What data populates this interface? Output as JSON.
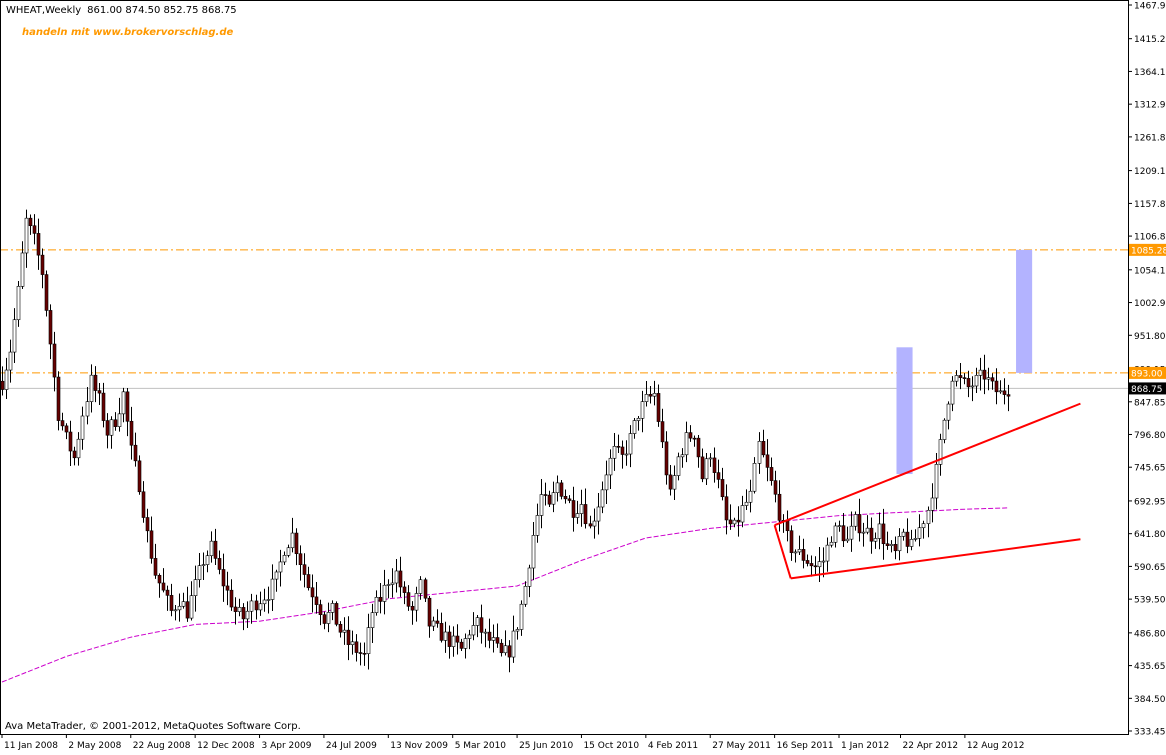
{
  "header": {
    "symbol": "WHEAT,Weekly",
    "ohlc": "861.00 874.50 852.75 868.75",
    "promo": "handeln mit www.brokervorschlag.de"
  },
  "footer": {
    "copyright": "Ava MetaTrader, © 2001-2012, MetaQuotes Software Corp."
  },
  "colors": {
    "background": "#ffffff",
    "frame": "#000000",
    "candle_up": "#ffffff",
    "candle_down": "#660000",
    "candle_outline": "#000000",
    "moving_average": "#cc00cc",
    "level_line": "#ff9900",
    "trendline": "#ff0000",
    "target_box": "#b3b3ff",
    "promo_text": "#ff9900",
    "current_price_bg": "#000000",
    "level_tag_bg": "#ff9900"
  },
  "chart_data": {
    "type": "candlestick",
    "symbol": "WHEAT",
    "timeframe": "Weekly",
    "ylim": [
      333.45,
      1467.9
    ],
    "y_ticks": [
      1467.9,
      1415.25,
      1364.1,
      1312.95,
      1261.8,
      1209.15,
      1157.85,
      1106.8,
      1054.1,
      1002.95,
      951.8,
      899.15,
      847.85,
      796.8,
      745.65,
      692.95,
      641.8,
      590.65,
      539.5,
      486.8,
      435.65,
      384.5,
      333.45
    ],
    "y_tick_labels": [
      "1467.90",
      "1415.25",
      "1364.10",
      "1312.95",
      "1261.80",
      "1209.15",
      "1157.85",
      "1106.80",
      "1054.10",
      "1002.95",
      "951.80",
      "899.15",
      "847.85",
      "796.80",
      "745.65",
      "692.95",
      "641.80",
      "590.65",
      "539.50",
      "486.80",
      "435.65",
      "384.50",
      "333.45"
    ],
    "x_start": "2008-01-11",
    "x_end": "2012-10-26",
    "x_ticks": [
      "2008-01-11",
      "2008-05-02",
      "2008-08-22",
      "2008-12-12",
      "2009-04-03",
      "2009-07-24",
      "2009-11-13",
      "2010-03-05",
      "2010-06-25",
      "2010-10-15",
      "2011-02-04",
      "2011-05-27",
      "2011-09-16",
      "2012-01-06",
      "2012-04-22",
      "2012-08-12"
    ],
    "x_tick_labels": [
      "11 Jan 2008",
      "2 May 2008",
      "22 Aug 2008",
      "12 Dec 2008",
      "3 Apr 2009",
      "24 Jul 2009",
      "13 Nov 2009",
      "5 Mar 2010",
      "25 Jun 2010",
      "15 Oct 2010",
      "4 Feb 2011",
      "27 May 2011",
      "16 Sep 2011",
      "1 Jan 2012",
      "22 Apr 2012",
      "12 Aug 2012"
    ],
    "price_path": [
      [
        "2008-01-11",
        880
      ],
      [
        "2008-01-25",
        930
      ],
      [
        "2008-02-08",
        1020
      ],
      [
        "2008-02-22",
        1130
      ],
      [
        "2008-03-07",
        1100
      ],
      [
        "2008-03-21",
        1050
      ],
      [
        "2008-04-04",
        940
      ],
      [
        "2008-04-18",
        830
      ],
      [
        "2008-05-02",
        790
      ],
      [
        "2008-05-16",
        760
      ],
      [
        "2008-05-30",
        830
      ],
      [
        "2008-06-13",
        880
      ],
      [
        "2008-06-27",
        850
      ],
      [
        "2008-07-11",
        800
      ],
      [
        "2008-07-25",
        820
      ],
      [
        "2008-08-08",
        860
      ],
      [
        "2008-08-22",
        770
      ],
      [
        "2008-09-05",
        720
      ],
      [
        "2008-09-19",
        640
      ],
      [
        "2008-10-03",
        580
      ],
      [
        "2008-10-17",
        550
      ],
      [
        "2008-10-31",
        520
      ],
      [
        "2008-11-14",
        540
      ],
      [
        "2008-11-28",
        520
      ],
      [
        "2008-12-12",
        560
      ],
      [
        "2008-12-26",
        600
      ],
      [
        "2009-01-09",
        620
      ],
      [
        "2009-01-23",
        580
      ],
      [
        "2009-02-06",
        550
      ],
      [
        "2009-02-20",
        520
      ],
      [
        "2009-03-06",
        510
      ],
      [
        "2009-03-20",
        530
      ],
      [
        "2009-04-03",
        540
      ],
      [
        "2009-04-17",
        550
      ],
      [
        "2009-05-01",
        570
      ],
      [
        "2009-05-15",
        620
      ],
      [
        "2009-05-29",
        640
      ],
      [
        "2009-06-12",
        600
      ],
      [
        "2009-06-26",
        560
      ],
      [
        "2009-07-10",
        540
      ],
      [
        "2009-07-24",
        510
      ],
      [
        "2009-08-07",
        520
      ],
      [
        "2009-08-21",
        490
      ],
      [
        "2009-09-04",
        470
      ],
      [
        "2009-09-18",
        460
      ],
      [
        "2009-10-02",
        450
      ],
      [
        "2009-10-16",
        520
      ],
      [
        "2009-10-30",
        540
      ],
      [
        "2009-11-13",
        570
      ],
      [
        "2009-11-27",
        580
      ],
      [
        "2009-12-11",
        540
      ],
      [
        "2009-12-25",
        520
      ],
      [
        "2010-01-08",
        560
      ],
      [
        "2010-01-22",
        500
      ],
      [
        "2010-02-05",
        490
      ],
      [
        "2010-02-19",
        480
      ],
      [
        "2010-03-05",
        470
      ],
      [
        "2010-03-19",
        460
      ],
      [
        "2010-04-02",
        490
      ],
      [
        "2010-04-16",
        500
      ],
      [
        "2010-04-30",
        480
      ],
      [
        "2010-05-14",
        470
      ],
      [
        "2010-05-28",
        450
      ],
      [
        "2010-06-11",
        460
      ],
      [
        "2010-06-25",
        500
      ],
      [
        "2010-07-09",
        560
      ],
      [
        "2010-07-23",
        640
      ],
      [
        "2010-08-06",
        700
      ],
      [
        "2010-08-20",
        680
      ],
      [
        "2010-09-03",
        720
      ],
      [
        "2010-09-17",
        700
      ],
      [
        "2010-10-01",
        680
      ],
      [
        "2010-10-15",
        690
      ],
      [
        "2010-10-29",
        650
      ],
      [
        "2010-11-12",
        690
      ],
      [
        "2010-11-26",
        740
      ],
      [
        "2010-12-10",
        770
      ],
      [
        "2010-12-24",
        760
      ],
      [
        "2011-01-07",
        790
      ],
      [
        "2011-01-21",
        830
      ],
      [
        "2011-02-04",
        850
      ],
      [
        "2011-02-18",
        860
      ],
      [
        "2011-03-04",
        780
      ],
      [
        "2011-03-18",
        700
      ],
      [
        "2011-04-01",
        760
      ],
      [
        "2011-04-15",
        790
      ],
      [
        "2011-04-29",
        800
      ],
      [
        "2011-05-13",
        730
      ],
      [
        "2011-05-27",
        770
      ],
      [
        "2011-06-10",
        720
      ],
      [
        "2011-06-24",
        660
      ],
      [
        "2011-07-08",
        650
      ],
      [
        "2011-07-22",
        680
      ],
      [
        "2011-08-05",
        700
      ],
      [
        "2011-08-19",
        780
      ],
      [
        "2011-09-02",
        740
      ],
      [
        "2011-09-16",
        700
      ],
      [
        "2011-09-30",
        650
      ],
      [
        "2011-10-14",
        620
      ],
      [
        "2011-10-28",
        610
      ],
      [
        "2011-11-11",
        600
      ],
      [
        "2011-11-25",
        590
      ],
      [
        "2011-12-09",
        600
      ],
      [
        "2011-12-23",
        640
      ],
      [
        "2012-01-06",
        650
      ],
      [
        "2012-01-20",
        630
      ],
      [
        "2012-02-03",
        660
      ],
      [
        "2012-02-17",
        650
      ],
      [
        "2012-03-02",
        640
      ],
      [
        "2012-03-16",
        650
      ],
      [
        "2012-03-30",
        620
      ],
      [
        "2012-04-13",
        610
      ],
      [
        "2012-04-27",
        640
      ],
      [
        "2012-05-11",
        620
      ],
      [
        "2012-05-25",
        650
      ],
      [
        "2012-06-08",
        680
      ],
      [
        "2012-06-22",
        740
      ],
      [
        "2012-07-06",
        820
      ],
      [
        "2012-07-20",
        890
      ],
      [
        "2012-08-03",
        880
      ],
      [
        "2012-08-17",
        870
      ],
      [
        "2012-08-31",
        880
      ],
      [
        "2012-09-14",
        890
      ],
      [
        "2012-09-28",
        870
      ],
      [
        "2012-10-12",
        860
      ],
      [
        "2012-10-26",
        868.75
      ]
    ],
    "moving_average": [
      [
        "2008-01-11",
        410
      ],
      [
        "2008-05-02",
        450
      ],
      [
        "2008-08-22",
        480
      ],
      [
        "2008-12-12",
        500
      ],
      [
        "2009-04-03",
        505
      ],
      [
        "2009-07-24",
        520
      ],
      [
        "2009-11-13",
        540
      ],
      [
        "2010-03-05",
        550
      ],
      [
        "2010-06-25",
        560
      ],
      [
        "2010-10-15",
        600
      ],
      [
        "2011-02-04",
        635
      ],
      [
        "2011-05-27",
        650
      ],
      [
        "2011-09-16",
        660
      ],
      [
        "2012-01-06",
        670
      ],
      [
        "2012-04-22",
        675
      ],
      [
        "2012-08-12",
        680
      ],
      [
        "2012-10-26",
        682
      ]
    ],
    "levels": [
      {
        "label": "1085.28",
        "value": 1085.28
      },
      {
        "label": "893.00",
        "value": 893.0
      },
      {
        "label": "868.75",
        "value": 868.75
      }
    ],
    "trendlines": [
      {
        "from": [
          "2011-09-16",
          655
        ],
        "to": [
          "2013-03-01",
          845
        ]
      },
      {
        "from": [
          "2011-10-14",
          572
        ],
        "to": [
          "2012-04-27",
          590
        ],
        "extend_to": [
          "2013-03-01",
          633
        ]
      },
      {
        "from": [
          "2011-10-14",
          572
        ],
        "to": [
          "2011-09-16",
          655
        ]
      }
    ],
    "target_boxes": [
      {
        "x0": "2012-04-15",
        "x1": "2012-05-13",
        "y0": 735,
        "y1": 933
      },
      {
        "x0": "2012-11-09",
        "x1": "2012-12-07",
        "y0": 893,
        "y1": 1085.28
      }
    ]
  }
}
